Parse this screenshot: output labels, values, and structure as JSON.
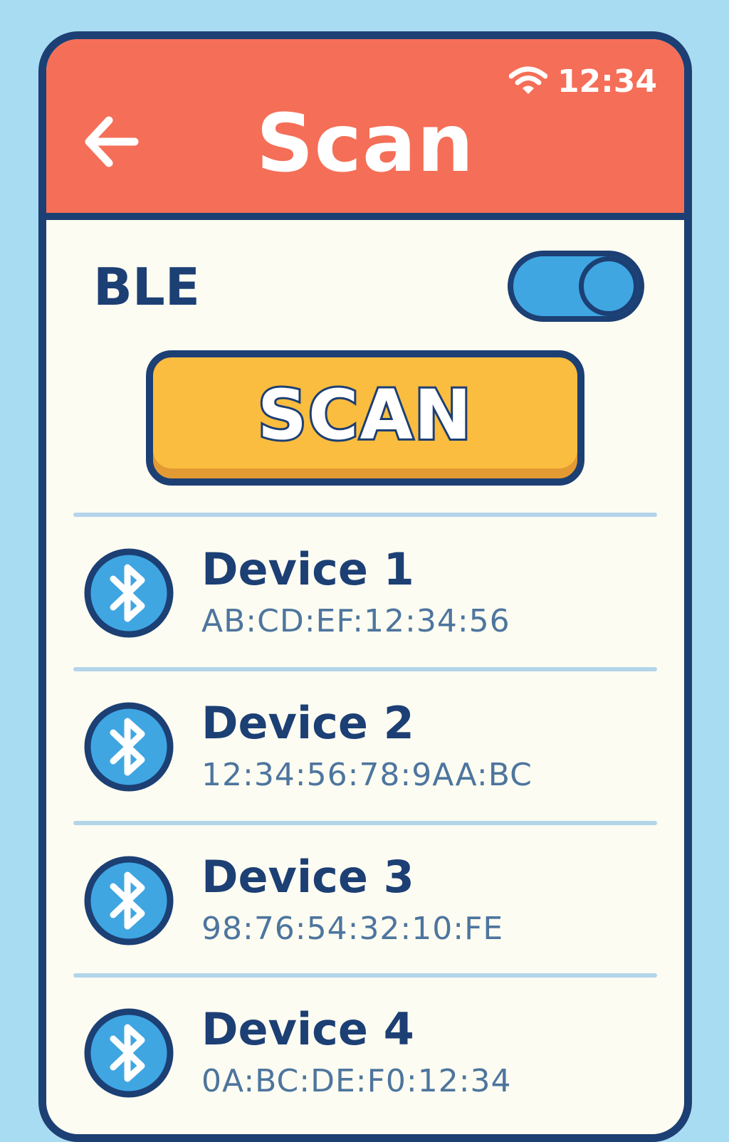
{
  "status_bar": {
    "wifi_icon": "wifi-icon",
    "time": "12:34"
  },
  "header": {
    "back_icon": "arrow-left-icon",
    "title": "Scan"
  },
  "ble": {
    "label": "BLE",
    "enabled": true
  },
  "scan_button": {
    "label": "SCAN"
  },
  "devices": [
    {
      "name": "Device 1",
      "mac": "AB:CD:EF:12:34:56",
      "icon": "bluetooth-icon"
    },
    {
      "name": "Device 2",
      "mac": "12:34:56:78:9AA:BC",
      "icon": "bluetooth-icon"
    },
    {
      "name": "Device 3",
      "mac": "98:76:54:32:10:FE",
      "icon": "bluetooth-icon"
    },
    {
      "name": "Device 4",
      "mac": "0A:BC:DE:F0:12:34",
      "icon": "bluetooth-icon"
    }
  ],
  "colors": {
    "background": "#a8dcf2",
    "header": "#f56e57",
    "outline": "#1c3f74",
    "accent_blue": "#3fa6e2",
    "button": "#fbbd3f",
    "surface": "#fdfcf2",
    "divider": "#b3d5ea"
  }
}
